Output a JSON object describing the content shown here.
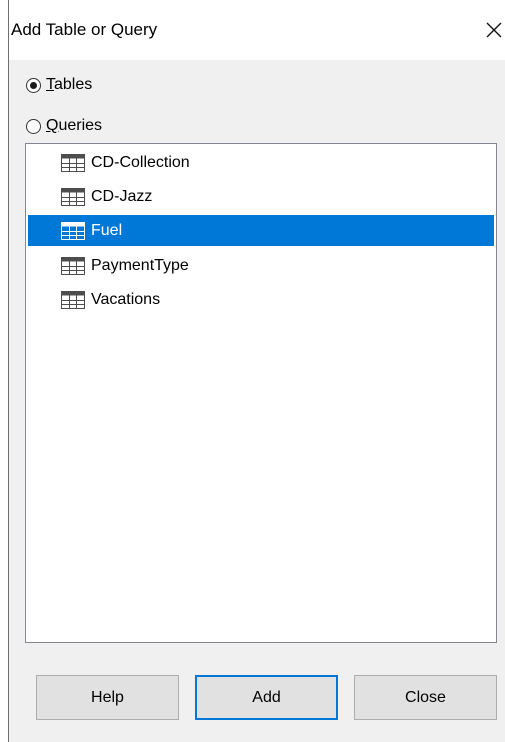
{
  "dialog": {
    "title": "Add Table or Query",
    "close_icon": "close-icon"
  },
  "source_options": [
    {
      "label": "Tables",
      "checked": true
    },
    {
      "label": "Queries",
      "checked": false
    }
  ],
  "list": {
    "item_icon": "table-icon",
    "selected_index": 2,
    "items": [
      {
        "label": "CD-Collection"
      },
      {
        "label": "CD-Jazz"
      },
      {
        "label": "Fuel"
      },
      {
        "label": "PaymentType"
      },
      {
        "label": "Vacations"
      }
    ]
  },
  "buttons": {
    "help": "Help",
    "add": "Add",
    "close": "Close"
  },
  "colors": {
    "selection": "#0078d7",
    "default_button_border": "#0078d7",
    "dialog_background": "#f0f0f0"
  }
}
